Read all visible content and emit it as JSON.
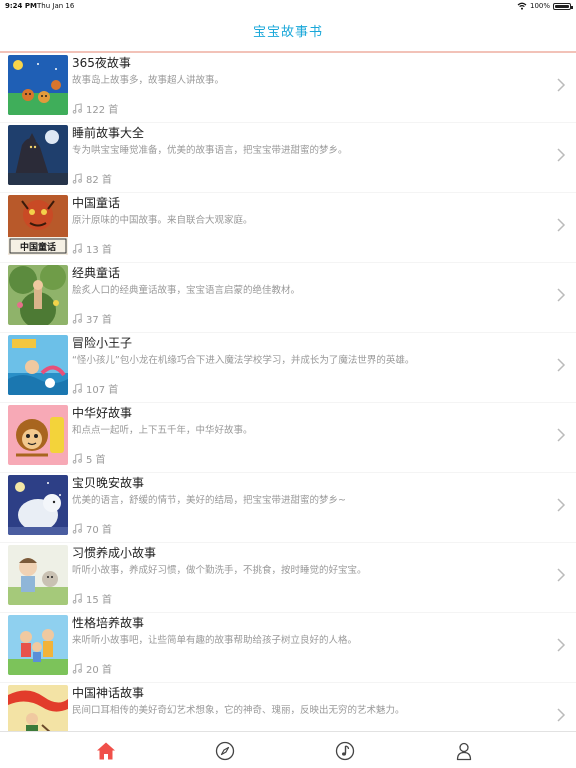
{
  "status": {
    "time": "9:24 PM",
    "date": "Thu Jan 16",
    "battery": "100%"
  },
  "nav": {
    "title": "宝宝故事书"
  },
  "colors": {
    "accent": "#19a7d9",
    "tab_active": "#f0504a",
    "tab_inactive": "#555555"
  },
  "books": [
    {
      "name": "365夜故事",
      "desc": "故事岛上故事多，故事超人讲故事。",
      "count": "122 首"
    },
    {
      "name": "睡前故事大全",
      "desc": "专为哄宝宝睡觉准备，优美的故事语言，把宝宝带进甜蜜的梦乡。",
      "count": "82 首"
    },
    {
      "name": "中国童话",
      "desc": "原汁原味的中国故事。来自联合大观家庭。",
      "count": "13 首",
      "cover_text": "中国童话"
    },
    {
      "name": "经典童话",
      "desc": "脍炙人口的经典童话故事，宝宝语言启蒙的绝佳教材。",
      "count": "37 首"
    },
    {
      "name": "冒险小王子",
      "desc": "“怪小孩儿”包小龙在机缘巧合下进入魔法学校学习，并成长为了魔法世界的英雄。",
      "count": "107 首"
    },
    {
      "name": "中华好故事",
      "desc": "和点点一起听，上下五千年，中华好故事。",
      "count": "5 首"
    },
    {
      "name": "宝贝晚安故事",
      "desc": "优美的语言，舒缓的情节，美好的结局，把宝宝带进甜蜜的梦乡~",
      "count": "70 首"
    },
    {
      "name": "习惯养成小故事",
      "desc": "听听小故事，养成好习惯，做个勤洗手，不挑食，按时睡觉的好宝宝。",
      "count": "15 首"
    },
    {
      "name": "性格培养故事",
      "desc": "来听听小故事吧，让些简单有趣的故事帮助给孩子树立良好的人格。",
      "count": "20 首"
    },
    {
      "name": "中国神话故事",
      "desc": "民间口耳相传的美好奇幻艺术想象，它的神奇、瑰丽，反映出无穷的艺术魅力。",
      "count": ""
    }
  ],
  "tabs": [
    {
      "icon": "home-icon",
      "active": true
    },
    {
      "icon": "compass-icon",
      "active": false
    },
    {
      "icon": "music-note-icon",
      "active": false
    },
    {
      "icon": "profile-icon",
      "active": false
    }
  ]
}
